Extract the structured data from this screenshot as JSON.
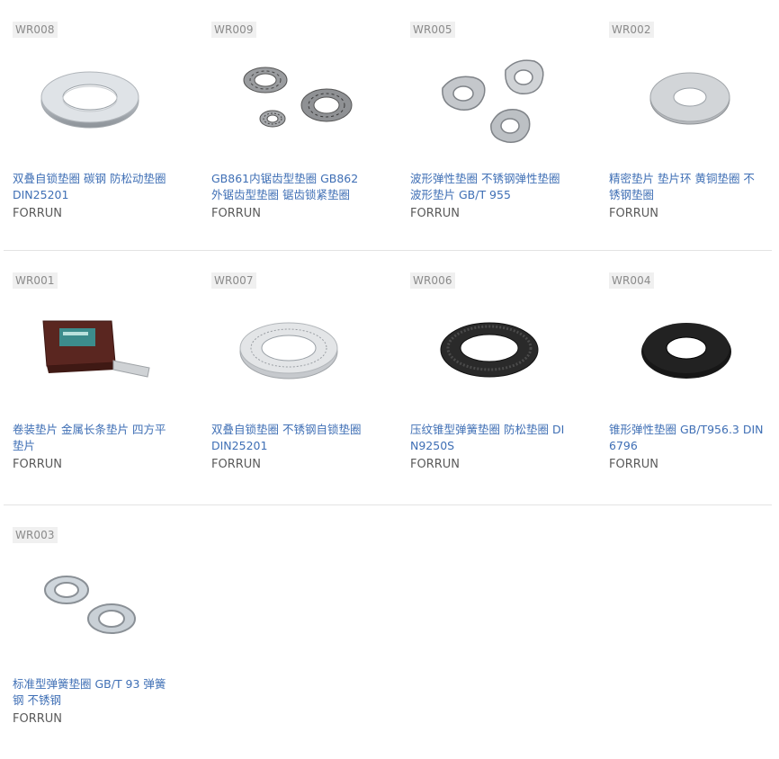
{
  "products": [
    {
      "sku": "WR008",
      "title": "双叠自锁垫圈 碳钢 防松动垫圈 DIN25201",
      "brand": "FORRUN",
      "icon": "double-lock-washer-steel"
    },
    {
      "sku": "WR009",
      "title": "GB861内锯齿型垫圈 GB862外锯齿型垫圈 锯齿锁紧垫圈",
      "brand": "FORRUN",
      "icon": "serrated-lock-washers"
    },
    {
      "sku": "WR005",
      "title": "波形弹性垫圈 不锈钢弹性垫圈 波形垫片 GB/T 955",
      "brand": "FORRUN",
      "icon": "wave-spring-washers"
    },
    {
      "sku": "WR002",
      "title": "精密垫片 垫片环 黄铜垫圈 不锈钢垫圈",
      "brand": "FORRUN",
      "icon": "precision-shim-washer"
    },
    {
      "sku": "WR001",
      "title": "卷装垫片 金属长条垫片 四方平垫片",
      "brand": "FORRUN",
      "icon": "shim-stock-roll-box"
    },
    {
      "sku": "WR007",
      "title": "双叠自锁垫圈 不锈钢自锁垫圈 DIN25201",
      "brand": "FORRUN",
      "icon": "double-lock-washer-stainless"
    },
    {
      "sku": "WR006",
      "title": "压纹锥型弹簧垫圈 防松垫圈 DIN9250S",
      "brand": "FORRUN",
      "icon": "ribbed-conical-washer-black"
    },
    {
      "sku": "WR004",
      "title": "锥形弹性垫圈 GB/T956.3 DIN 6796",
      "brand": "FORRUN",
      "icon": "conical-spring-washer-black"
    },
    {
      "sku": "WR003",
      "title": "标准型弹簧垫圈 GB/T 93 弹簧钢 不锈钢",
      "brand": "FORRUN",
      "icon": "split-lock-washers"
    }
  ],
  "colors": {
    "link": "#3f6fb5",
    "brand_text": "#5a5a5a",
    "sku_bg": "#f0f0f0",
    "sku_text": "#8a8a8a",
    "divider": "#e3e3e3"
  }
}
